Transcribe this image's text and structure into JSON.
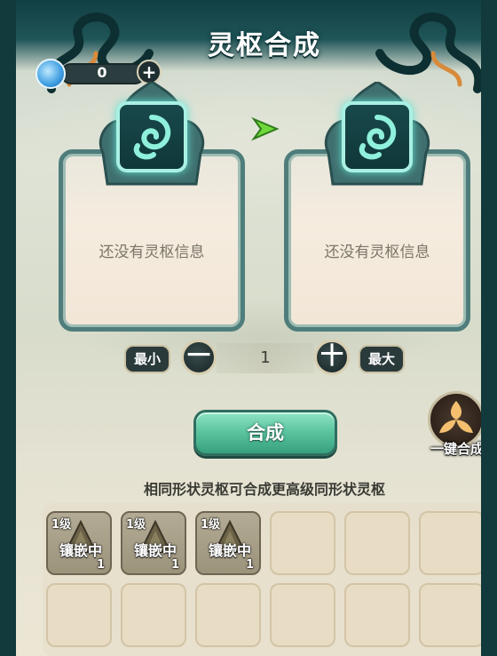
{
  "header": {
    "title": "灵枢合成"
  },
  "currency": {
    "value": "0",
    "add_icon": "+"
  },
  "cards": {
    "left": {
      "empty_text": "还没有灵枢信息"
    },
    "right": {
      "empty_text": "还没有灵枢信息"
    }
  },
  "controls": {
    "min_label": "最小",
    "max_label": "最大",
    "minus_icon": "一",
    "plus_icon": "十",
    "quantity": "1"
  },
  "actions": {
    "synthesize_label": "合成",
    "one_click_label": "一键合成"
  },
  "hint": "相同形状灵枢可合成更高级同形状灵枢",
  "inventory": {
    "items": [
      {
        "level": "1级",
        "status": "镶嵌中",
        "count": "1"
      },
      {
        "level": "1级",
        "status": "镶嵌中",
        "count": "1"
      },
      {
        "level": "1级",
        "status": "镶嵌中",
        "count": "1"
      }
    ]
  },
  "colors": {
    "accent_green": "#58c39d",
    "frame_teal": "#4f7d7b",
    "rune_glow": "#a9f0e3"
  }
}
